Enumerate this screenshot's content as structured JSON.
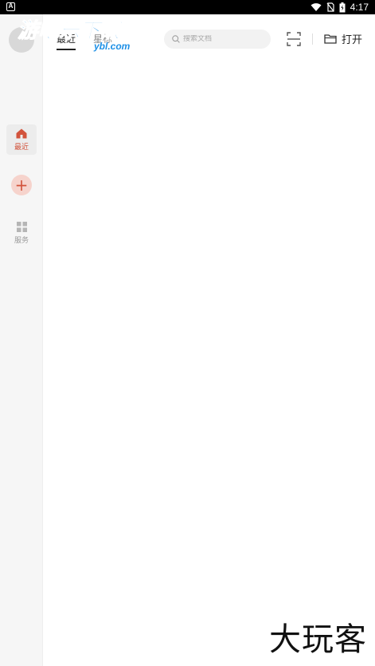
{
  "status_bar": {
    "left_badge": "A",
    "time": "4:17"
  },
  "sidebar": {
    "items": [
      {
        "label": "最近",
        "icon": "home-icon",
        "active": true
      },
      {
        "label": "服务",
        "icon": "grid-icon",
        "active": false
      }
    ],
    "add_label": "+"
  },
  "header": {
    "tabs": [
      {
        "label": "最近",
        "active": true
      },
      {
        "label": "星标",
        "active": false
      }
    ],
    "search": {
      "placeholder": "搜索文档"
    },
    "open_label": "打开"
  },
  "watermark": {
    "text": "游吧乐下载",
    "sub": "ybl.com"
  },
  "corner_mark": "大玩客",
  "colors": {
    "accent": "#d2533c",
    "accent_light": "#f6d3cc",
    "sidebar_bg": "#f6f6f6",
    "watermark_blue": "#1e90e6"
  }
}
